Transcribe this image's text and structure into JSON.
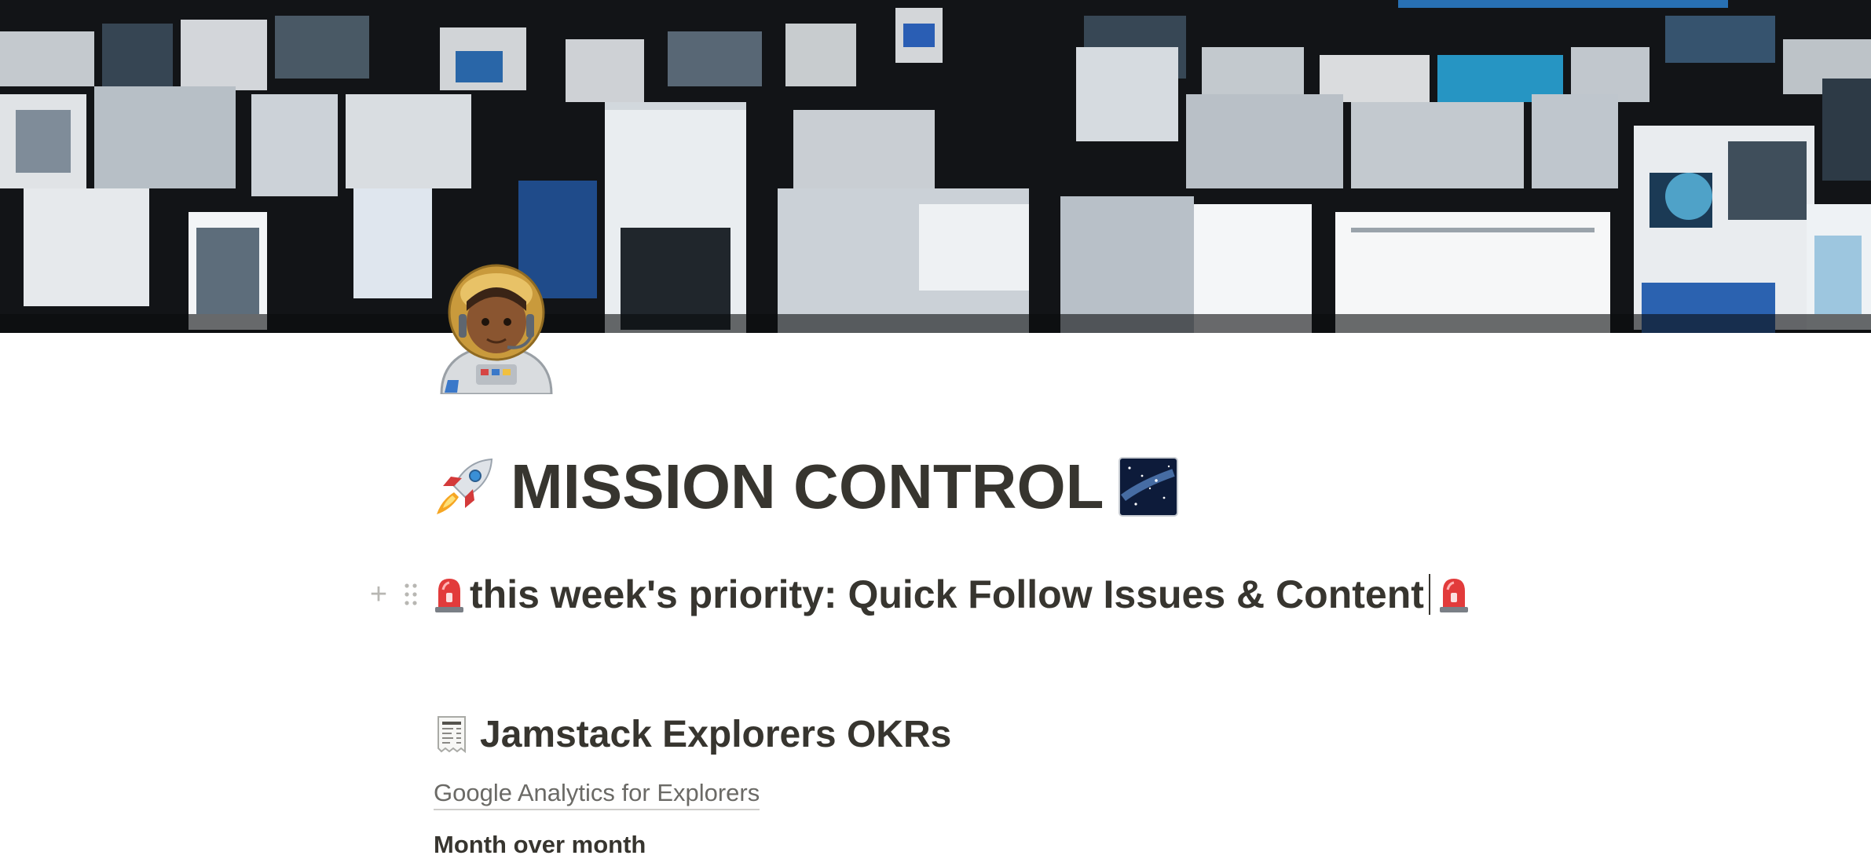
{
  "page": {
    "title": "MISSION CONTROL",
    "title_emoji_left": "rocket",
    "title_emoji_right": "milky-way",
    "page_icon": "astronaut"
  },
  "priority_block": {
    "prefix_emoji": "police-light",
    "text": "this week's priority: Quick Follow Issues & Content",
    "suffix_emoji": "police-light"
  },
  "okr_section": {
    "emoji": "receipt",
    "heading": "Jamstack Explorers OKRs",
    "link_text": "Google Analytics for Explorers",
    "subheading": "Month over month"
  },
  "colors": {
    "text": "#37352f",
    "muted_text": "#6b6a66",
    "handle": "#b8b7b3"
  }
}
